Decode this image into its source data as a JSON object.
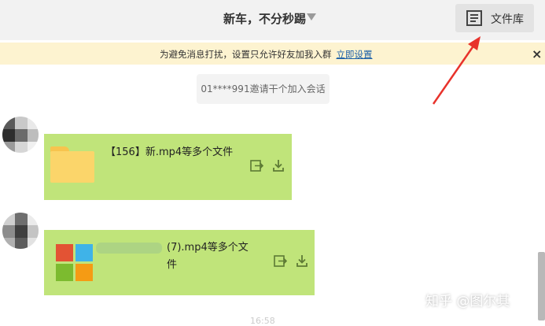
{
  "header": {
    "chat_title": "新车，不分秒踢",
    "file_library_label": "文件库"
  },
  "notice": {
    "text": "为避免消息打扰，设置只允许好友加我入群",
    "link": "立即设置",
    "close": "×"
  },
  "system_message": "01****991邀请干个加入会话",
  "messages": [
    {
      "text": "【156】新.mp4等多个文件",
      "icon": "folder-icon"
    },
    {
      "text": "(7).mp4等多个文件",
      "icon": "file-tiles-icon"
    }
  ],
  "watermark": "知乎 @图尔其",
  "colors": {
    "bubble": "#c0e47a",
    "notice_bg": "#fdf3d0",
    "link": "#1a5fa8",
    "arrow": "#e8322b"
  }
}
